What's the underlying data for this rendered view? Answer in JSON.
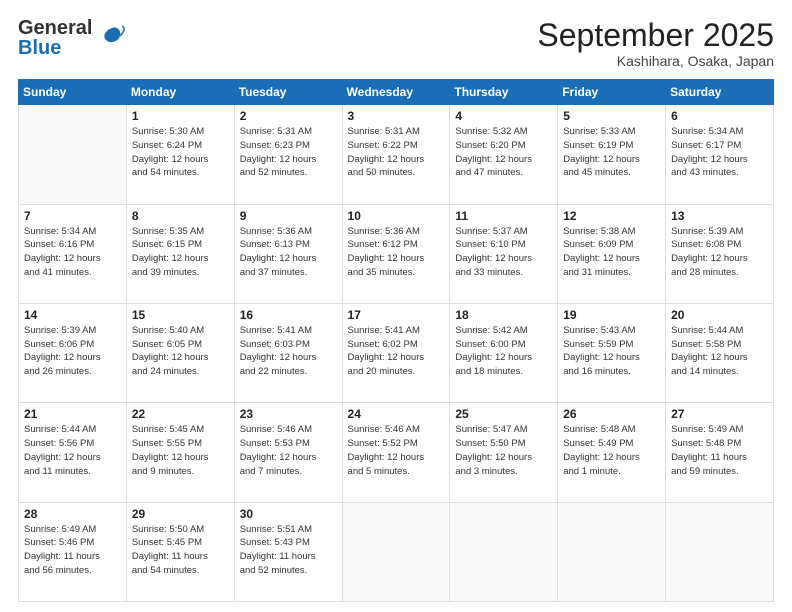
{
  "header": {
    "logo_general": "General",
    "logo_blue": "Blue",
    "month_title": "September 2025",
    "location": "Kashihara, Osaka, Japan"
  },
  "days_of_week": [
    "Sunday",
    "Monday",
    "Tuesday",
    "Wednesday",
    "Thursday",
    "Friday",
    "Saturday"
  ],
  "weeks": [
    [
      {
        "day": "",
        "info": ""
      },
      {
        "day": "1",
        "info": "Sunrise: 5:30 AM\nSunset: 6:24 PM\nDaylight: 12 hours\nand 54 minutes."
      },
      {
        "day": "2",
        "info": "Sunrise: 5:31 AM\nSunset: 6:23 PM\nDaylight: 12 hours\nand 52 minutes."
      },
      {
        "day": "3",
        "info": "Sunrise: 5:31 AM\nSunset: 6:22 PM\nDaylight: 12 hours\nand 50 minutes."
      },
      {
        "day": "4",
        "info": "Sunrise: 5:32 AM\nSunset: 6:20 PM\nDaylight: 12 hours\nand 47 minutes."
      },
      {
        "day": "5",
        "info": "Sunrise: 5:33 AM\nSunset: 6:19 PM\nDaylight: 12 hours\nand 45 minutes."
      },
      {
        "day": "6",
        "info": "Sunrise: 5:34 AM\nSunset: 6:17 PM\nDaylight: 12 hours\nand 43 minutes."
      }
    ],
    [
      {
        "day": "7",
        "info": "Sunrise: 5:34 AM\nSunset: 6:16 PM\nDaylight: 12 hours\nand 41 minutes."
      },
      {
        "day": "8",
        "info": "Sunrise: 5:35 AM\nSunset: 6:15 PM\nDaylight: 12 hours\nand 39 minutes."
      },
      {
        "day": "9",
        "info": "Sunrise: 5:36 AM\nSunset: 6:13 PM\nDaylight: 12 hours\nand 37 minutes."
      },
      {
        "day": "10",
        "info": "Sunrise: 5:36 AM\nSunset: 6:12 PM\nDaylight: 12 hours\nand 35 minutes."
      },
      {
        "day": "11",
        "info": "Sunrise: 5:37 AM\nSunset: 6:10 PM\nDaylight: 12 hours\nand 33 minutes."
      },
      {
        "day": "12",
        "info": "Sunrise: 5:38 AM\nSunset: 6:09 PM\nDaylight: 12 hours\nand 31 minutes."
      },
      {
        "day": "13",
        "info": "Sunrise: 5:39 AM\nSunset: 6:08 PM\nDaylight: 12 hours\nand 28 minutes."
      }
    ],
    [
      {
        "day": "14",
        "info": "Sunrise: 5:39 AM\nSunset: 6:06 PM\nDaylight: 12 hours\nand 26 minutes."
      },
      {
        "day": "15",
        "info": "Sunrise: 5:40 AM\nSunset: 6:05 PM\nDaylight: 12 hours\nand 24 minutes."
      },
      {
        "day": "16",
        "info": "Sunrise: 5:41 AM\nSunset: 6:03 PM\nDaylight: 12 hours\nand 22 minutes."
      },
      {
        "day": "17",
        "info": "Sunrise: 5:41 AM\nSunset: 6:02 PM\nDaylight: 12 hours\nand 20 minutes."
      },
      {
        "day": "18",
        "info": "Sunrise: 5:42 AM\nSunset: 6:00 PM\nDaylight: 12 hours\nand 18 minutes."
      },
      {
        "day": "19",
        "info": "Sunrise: 5:43 AM\nSunset: 5:59 PM\nDaylight: 12 hours\nand 16 minutes."
      },
      {
        "day": "20",
        "info": "Sunrise: 5:44 AM\nSunset: 5:58 PM\nDaylight: 12 hours\nand 14 minutes."
      }
    ],
    [
      {
        "day": "21",
        "info": "Sunrise: 5:44 AM\nSunset: 5:56 PM\nDaylight: 12 hours\nand 11 minutes."
      },
      {
        "day": "22",
        "info": "Sunrise: 5:45 AM\nSunset: 5:55 PM\nDaylight: 12 hours\nand 9 minutes."
      },
      {
        "day": "23",
        "info": "Sunrise: 5:46 AM\nSunset: 5:53 PM\nDaylight: 12 hours\nand 7 minutes."
      },
      {
        "day": "24",
        "info": "Sunrise: 5:46 AM\nSunset: 5:52 PM\nDaylight: 12 hours\nand 5 minutes."
      },
      {
        "day": "25",
        "info": "Sunrise: 5:47 AM\nSunset: 5:50 PM\nDaylight: 12 hours\nand 3 minutes."
      },
      {
        "day": "26",
        "info": "Sunrise: 5:48 AM\nSunset: 5:49 PM\nDaylight: 12 hours\nand 1 minute."
      },
      {
        "day": "27",
        "info": "Sunrise: 5:49 AM\nSunset: 5:48 PM\nDaylight: 11 hours\nand 59 minutes."
      }
    ],
    [
      {
        "day": "28",
        "info": "Sunrise: 5:49 AM\nSunset: 5:46 PM\nDaylight: 11 hours\nand 56 minutes."
      },
      {
        "day": "29",
        "info": "Sunrise: 5:50 AM\nSunset: 5:45 PM\nDaylight: 11 hours\nand 54 minutes."
      },
      {
        "day": "30",
        "info": "Sunrise: 5:51 AM\nSunset: 5:43 PM\nDaylight: 11 hours\nand 52 minutes."
      },
      {
        "day": "",
        "info": ""
      },
      {
        "day": "",
        "info": ""
      },
      {
        "day": "",
        "info": ""
      },
      {
        "day": "",
        "info": ""
      }
    ]
  ]
}
